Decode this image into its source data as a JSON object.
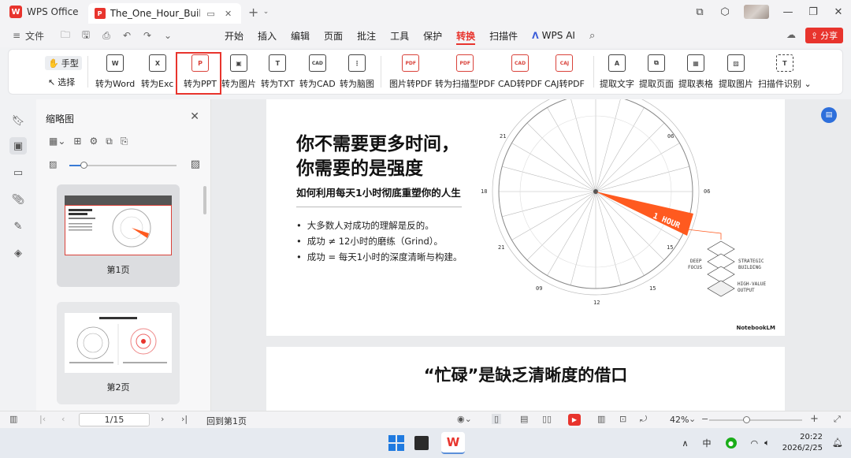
{
  "titlebar": {
    "app_name": "WPS Office",
    "doc_tab": "The_One_Hour_Build.pdf",
    "logo_letter": "W",
    "pdf_letter": "P"
  },
  "menubar": {
    "file": "文件",
    "tabs": [
      "开始",
      "插入",
      "编辑",
      "页面",
      "批注",
      "工具",
      "保护",
      "转换",
      "扫描件",
      "WPS AI"
    ],
    "active_tab": "转换",
    "share": "分享"
  },
  "ribbon": {
    "hand_tool": "手型",
    "select_tool": "选择",
    "items": [
      {
        "label": "转为Word",
        "icon": "W"
      },
      {
        "label": "转为Excel",
        "icon": "X"
      },
      {
        "label": "转为PPT",
        "icon": "P"
      },
      {
        "label": "转为图片",
        "icon": "▣"
      },
      {
        "label": "转为TXT",
        "icon": "T"
      },
      {
        "label": "转为CAD",
        "icon": "CAD"
      },
      {
        "label": "转为脑图",
        "icon": "⋮"
      },
      {
        "label": "图片转PDF",
        "icon": "PDF"
      },
      {
        "label": "转为扫描型PDF",
        "icon": "PDF"
      },
      {
        "label": "CAD转PDF",
        "icon": "CAD"
      },
      {
        "label": "CAJ转PDF",
        "icon": "CAJ"
      },
      {
        "label": "提取文字",
        "icon": "A"
      },
      {
        "label": "提取页面",
        "icon": "⧉"
      },
      {
        "label": "提取表格",
        "icon": "▦"
      },
      {
        "label": "提取图片",
        "icon": "▨"
      },
      {
        "label": "扫描件识别",
        "icon": "T"
      }
    ],
    "highlighted": "转为PPT"
  },
  "thumbnail_panel": {
    "title": "缩略图",
    "thumbs": [
      {
        "label": "第1页"
      },
      {
        "label": "第2页"
      }
    ]
  },
  "page1": {
    "title_line1": "你不需要更多时间，",
    "title_line2": "你需要的是强度",
    "subtitle": "如何利用每天1小时彻底重塑你的人生",
    "bullets": [
      "大多数人对成功的理解是反的。",
      "成功 ≠ 12小时的磨练（Grind）。",
      "成功 = 每天1小时的深度清晰与构建。"
    ],
    "dial": {
      "numbers": [
        "21",
        "06",
        "18",
        "06",
        "21",
        "15",
        "09",
        "12",
        "15"
      ],
      "wedge_label": "1 HOUR",
      "deep_focus_1": "DEEP",
      "deep_focus_2": "FOCUS",
      "strategic_1": "STRATEGIC",
      "strategic_2": "BUILDING",
      "high_value_1": "HIGH-VALUE",
      "high_value_2": "OUTPUT"
    },
    "watermark": "NotebookLM"
  },
  "page2": {
    "title": "“忙碌”是缺乏清晰度的借口"
  },
  "statusbar": {
    "page_indicator": "1/15",
    "back_to_first": "回到第1页",
    "zoom": "42%"
  },
  "taskbar": {
    "ime": "中",
    "time": "20:22",
    "date": "2026/2/25"
  },
  "colors": {
    "accent": "#e8342d",
    "wedge": "#ff5a1f",
    "blue": "#2e6fdb"
  }
}
